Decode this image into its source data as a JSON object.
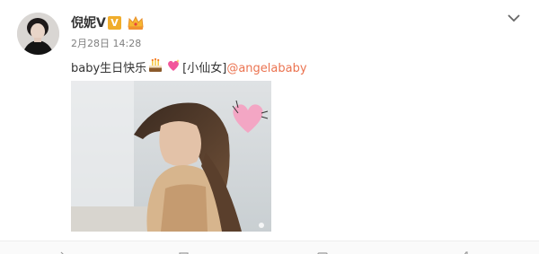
{
  "post": {
    "username": "倪妮V",
    "verified_mark": "V",
    "timestamp": "2月28日 14:28",
    "text_prefix": "baby生日快乐",
    "text_tag": "[小仙女]",
    "mention": "@angelababy"
  },
  "icons": {
    "crown": "crown-icon",
    "dropdown": "chevron-down-icon",
    "cake": "birthday-cake-emoji",
    "heart": "sparkling-heart-emoji",
    "actions": [
      "share-icon",
      "repost-icon",
      "comment-icon",
      "like-icon"
    ]
  },
  "colors": {
    "mention": "#eb7350",
    "verified_badge": "#f0ad2c",
    "meta_text": "#808080",
    "photo_heart": "#f3a6c4"
  }
}
